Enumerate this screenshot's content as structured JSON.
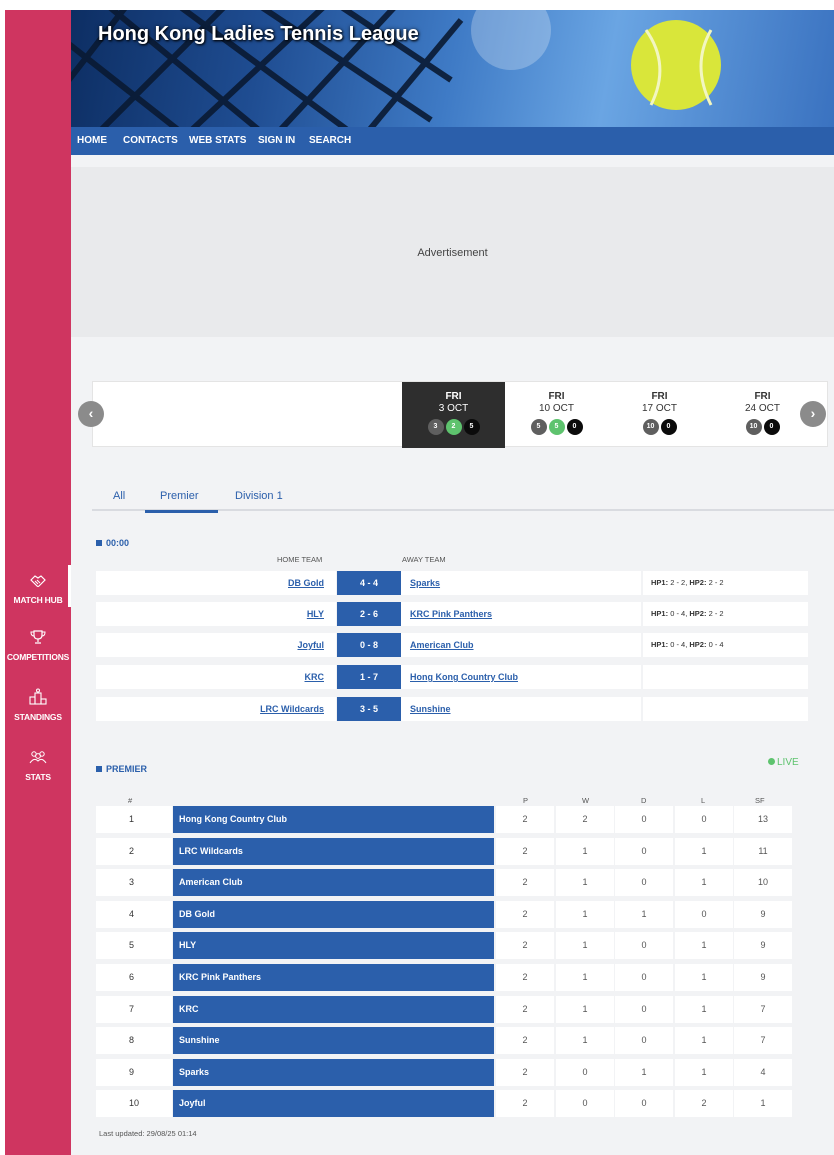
{
  "app": {
    "title": "Hong Kong Ladies Tennis League"
  },
  "nav": [
    {
      "label": "HOME"
    },
    {
      "label": "CONTACTS"
    },
    {
      "label": "WEB STATS"
    },
    {
      "label": "SIGN IN"
    },
    {
      "label": "SEARCH"
    }
  ],
  "sidebar": {
    "items": [
      {
        "label": "MATCH HUB",
        "icon": "handshake-icon"
      },
      {
        "label": "COMPETITIONS",
        "icon": "trophy-icon"
      },
      {
        "label": "STANDINGS",
        "icon": "podium-icon"
      },
      {
        "label": "STATS",
        "icon": "people-icon"
      }
    ]
  },
  "ad": {
    "label": "Advertisement"
  },
  "dates": [
    {
      "weekday": "FRI",
      "date": "3 OCT",
      "counts": [
        "3",
        "2",
        "5"
      ],
      "colors": [
        "gray",
        "green",
        "black"
      ],
      "active": true
    },
    {
      "weekday": "FRI",
      "date": "10 OCT",
      "counts": [
        "5",
        "5",
        "0"
      ],
      "colors": [
        "gray",
        "green",
        "black"
      ],
      "active": false
    },
    {
      "weekday": "FRI",
      "date": "17 OCT",
      "counts": [
        "10",
        "0"
      ],
      "colors": [
        "gray",
        "black"
      ],
      "active": false
    },
    {
      "weekday": "FRI",
      "date": "24 OCT",
      "counts": [
        "10",
        "0"
      ],
      "colors": [
        "gray",
        "black"
      ],
      "active": false
    }
  ],
  "tabs": [
    {
      "label": "All"
    },
    {
      "label": "Premier"
    },
    {
      "label": "Division 1"
    }
  ],
  "fixtures": {
    "time": "00:00",
    "home_header": "HOME TEAM",
    "away_header": "AWAY TEAM",
    "matches": [
      {
        "home": "DB Gold",
        "score": "4 - 4",
        "away": "Sparks",
        "hp1_label": "HP1:",
        "hp1": "2 - 2,",
        "hp2_label": "HP2:",
        "hp2": "2 - 2"
      },
      {
        "home": "HLY",
        "score": "2 - 6",
        "away": "KRC Pink Panthers",
        "hp1_label": "HP1:",
        "hp1": "0 - 4,",
        "hp2_label": "HP2:",
        "hp2": "2 - 2"
      },
      {
        "home": "Joyful",
        "score": "0 - 8",
        "away": "American Club",
        "hp1_label": "HP1:",
        "hp1": "0 - 4,",
        "hp2_label": "HP2:",
        "hp2": "0 - 4"
      },
      {
        "home": "KRC",
        "score": "1 - 7",
        "away": "Hong Kong Country Club",
        "hp1_label": "",
        "hp1": "",
        "hp2_label": "",
        "hp2": ""
      },
      {
        "home": "LRC Wildcards",
        "score": "3 - 5",
        "away": "Sunshine",
        "hp1_label": "",
        "hp1": "",
        "hp2_label": "",
        "hp2": ""
      }
    ]
  },
  "standings": {
    "title": "PREMIER",
    "live_label": "LIVE",
    "headers": {
      "pos": "#",
      "p": "P",
      "w": "W",
      "d": "D",
      "l": "L",
      "sf": "SF"
    },
    "rows": [
      {
        "pos": "1",
        "team": "Hong Kong Country Club",
        "p": "2",
        "w": "2",
        "d": "0",
        "l": "0",
        "sf": "13"
      },
      {
        "pos": "2",
        "team": "LRC Wildcards",
        "p": "2",
        "w": "1",
        "d": "0",
        "l": "1",
        "sf": "11"
      },
      {
        "pos": "3",
        "team": "American Club",
        "p": "2",
        "w": "1",
        "d": "0",
        "l": "1",
        "sf": "10"
      },
      {
        "pos": "4",
        "team": "DB Gold",
        "p": "2",
        "w": "1",
        "d": "1",
        "l": "0",
        "sf": "9"
      },
      {
        "pos": "5",
        "team": "HLY",
        "p": "2",
        "w": "1",
        "d": "0",
        "l": "1",
        "sf": "9"
      },
      {
        "pos": "6",
        "team": "KRC Pink Panthers",
        "p": "2",
        "w": "1",
        "d": "0",
        "l": "1",
        "sf": "9"
      },
      {
        "pos": "7",
        "team": "KRC",
        "p": "2",
        "w": "1",
        "d": "0",
        "l": "1",
        "sf": "7"
      },
      {
        "pos": "8",
        "team": "Sunshine",
        "p": "2",
        "w": "1",
        "d": "0",
        "l": "1",
        "sf": "7"
      },
      {
        "pos": "9",
        "team": "Sparks",
        "p": "2",
        "w": "0",
        "d": "1",
        "l": "1",
        "sf": "4"
      },
      {
        "pos": "10",
        "team": "Joyful",
        "p": "2",
        "w": "0",
        "d": "0",
        "l": "2",
        "sf": "1"
      }
    ],
    "last_updated": "Last updated: 29/08/25 01:14"
  },
  "colors": {
    "sidebar": "#cf3560",
    "primary": "#2b5fab",
    "live": "#5ec36e",
    "day_active": "#2e2e2e"
  }
}
